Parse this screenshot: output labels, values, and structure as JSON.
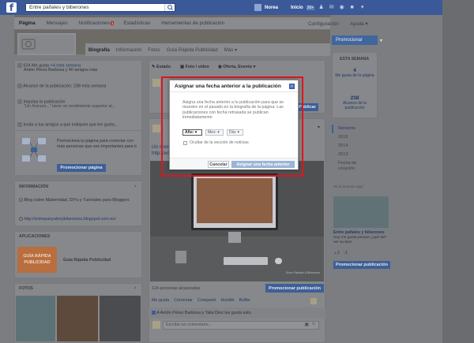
{
  "topbar": {
    "search_placeholder": "Entre pañales y biberones",
    "user_name": "Norea",
    "home_label": "Inicio",
    "home_count": "20+"
  },
  "nav": {
    "tabs": [
      {
        "label": "Página"
      },
      {
        "label": "Mensajes"
      },
      {
        "label": "Notificaciones",
        "badge": "1"
      },
      {
        "label": "Estadísticas"
      },
      {
        "label": "Herramientas de publicación"
      }
    ],
    "settings": "Configuración",
    "help": "Ayuda"
  },
  "subnav": {
    "tabs": [
      "Biografía",
      "Información",
      "Fotos",
      "Guía Rápida Publicidad",
      "Más"
    ]
  },
  "promote_button": "Promocionar",
  "left": {
    "likes_line": "624 Me gusta",
    "likes_week": "+4 esta semana",
    "likes_who": "Antón Pérez Barbosa y 40 amigos más",
    "reach": "Alcance de la publicación: 238",
    "reach_week": "esta semana",
    "boost": "Impulsa la publicación",
    "boost_sub": "\"Un #recurs...\" tiene un rendimiento superior al...",
    "invite": "Invita a tus amigos a que indiquen que les gusta...",
    "promo_text": "Promociona tu página para conectar con más personas que son importantes para ti",
    "promo_button": "Promocionar página",
    "info_header": "INFORMACIÓN",
    "info_blog": "Blog sobre Maternidad, DIYs y Tutoriales para Bloggers",
    "info_url": "http://entrepanyalesybiberones.blogspot.com.es/",
    "apps_header": "APLICACIONES",
    "app_thumb": "GUÍA RÁPIDA PUBLICIDAD",
    "app_label": "Guía Rápida Publicidad",
    "photos_header": "FOTOS"
  },
  "composer": {
    "status": "Estado",
    "photo": "Foto / vídeo",
    "offer": "Oferta, Evento",
    "publish": "Publicar"
  },
  "post": {
    "snip1": "Un #recu",
    "snip2": "http://en",
    "reach": "124 personas alcanzadas",
    "promote": "Promocionar publicación",
    "actions": [
      "Me gusta",
      "Comentar",
      "Compartir",
      "Hootlet",
      "Buffer"
    ],
    "likes": "A Antón Pérez Barbosa y Talia Diez les gusta esto.",
    "comment_placeholder": "Escribe un comentario...",
    "photo_credit": "Entre Pañales & Biberones"
  },
  "right": {
    "week_header": "ESTA SEMANA",
    "stat1_num": "4",
    "stat1_label": "Me gusta de la página",
    "stat2_num": "238",
    "stat2_label": "Alcance de la publicación",
    "timeline": [
      "Reciente",
      "2015",
      "2014",
      "2013",
      "Fecha de creación"
    ],
    "liked_as": "Ve lo anuncio aquí",
    "promo_title": "Entre pañales y biberones",
    "promo_sub": "Hoy me gusta porque ¿qué tal? ver su bien",
    "promo_likes": "2",
    "promo_comments": "1",
    "promo_button": "Promocionar publicación"
  },
  "modal": {
    "title": "Asignar una fecha anterior a la publicación",
    "description": "Asigna una fecha anterior a tu publicación para que se muestre en el pasado en la biografía de la página. Las publicaciones con fecha retrasada se publican inmediatamente",
    "year": "Año:",
    "month": "Mes:",
    "day": "Día:",
    "hide_label": "Ocultar de la sección de noticias",
    "cancel": "Cancelar",
    "assign": "Asignar una fecha anterior"
  },
  "colors": {
    "facebook_blue": "#3b5998",
    "highlight_red": "#e0151b"
  }
}
